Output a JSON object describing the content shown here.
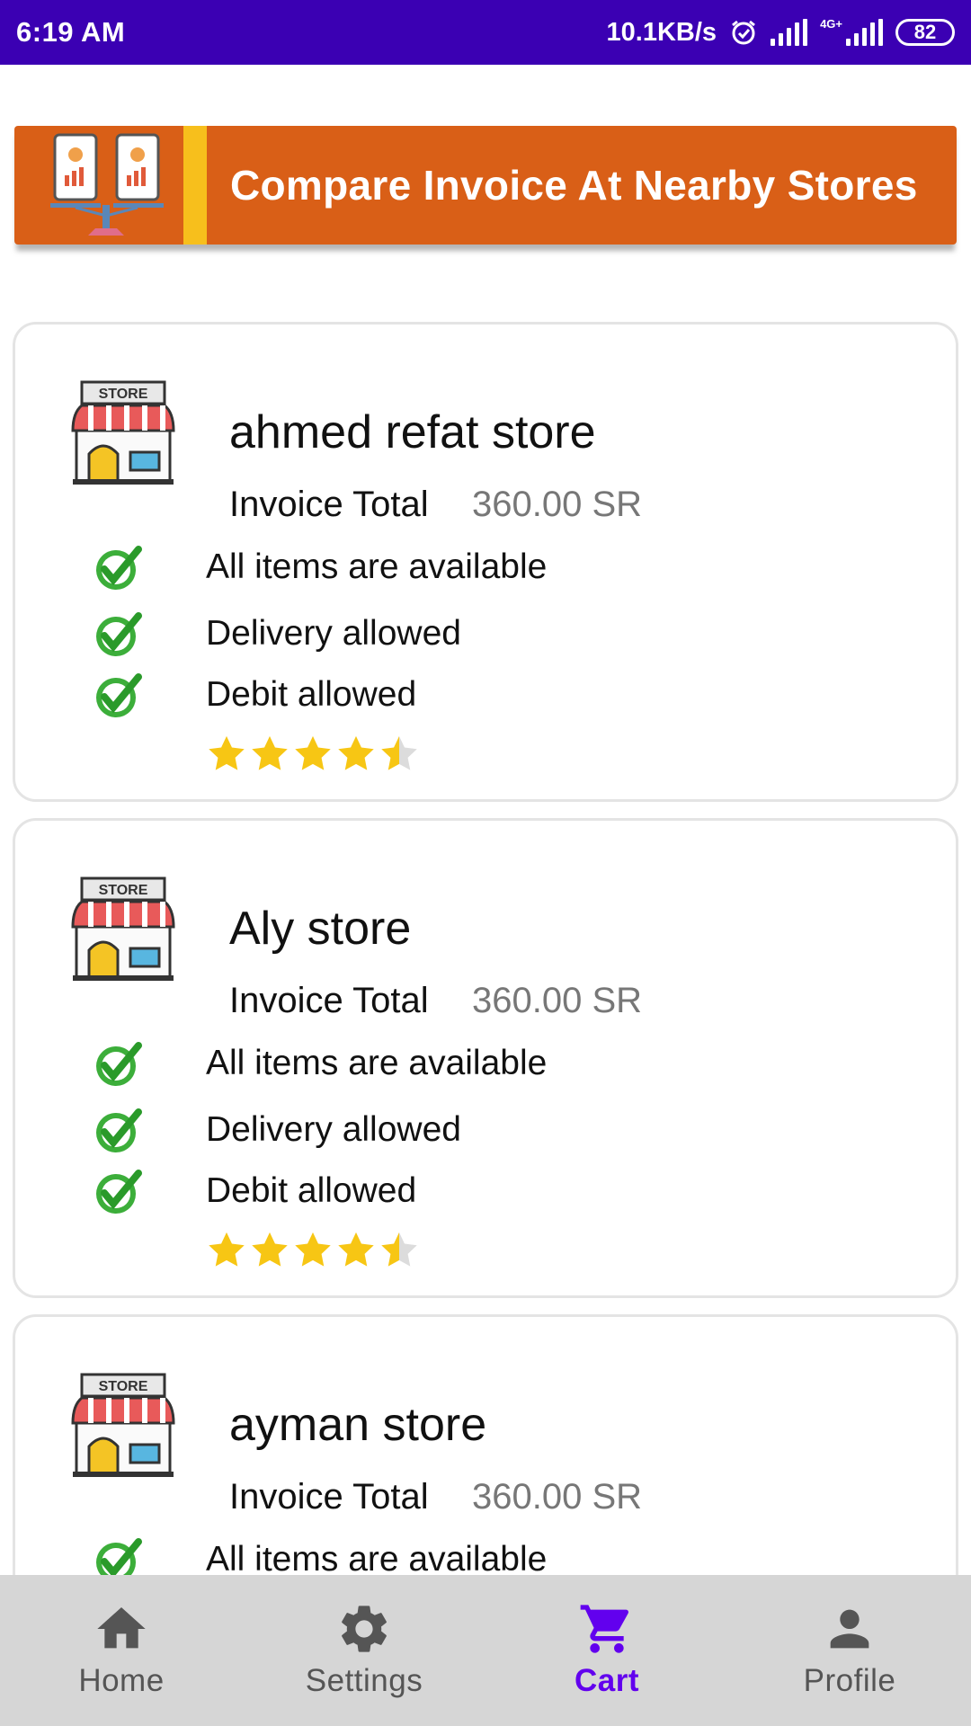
{
  "status_bar": {
    "time": "6:19 AM",
    "network_speed": "10.1KB/s",
    "network_type": "4G+",
    "battery": "82"
  },
  "banner": {
    "title": "Compare Invoice At Nearby Stores",
    "colors": {
      "background": "#d95f17",
      "stripe": "#f7bf1c"
    }
  },
  "stores": [
    {
      "logo_label": "STORE",
      "name": "ahmed refat store",
      "invoice_label": "Invoice Total",
      "invoice_total": "360.00 SR",
      "features": [
        "All items are available",
        "Delivery allowed",
        "Debit allowed"
      ],
      "rating": 4.5
    },
    {
      "logo_label": "STORE",
      "name": "Aly store",
      "invoice_label": "Invoice Total",
      "invoice_total": "360.00 SR",
      "features": [
        "All items are available",
        "Delivery allowed",
        "Debit allowed"
      ],
      "rating": 4.5
    },
    {
      "logo_label": "STORE",
      "name": "ayman store",
      "invoice_label": "Invoice Total",
      "invoice_total": "360.00 SR",
      "features": [
        "All items are available"
      ]
    }
  ],
  "bottom_nav": {
    "items": [
      {
        "label": "Home",
        "icon": "home-icon"
      },
      {
        "label": "Settings",
        "icon": "gear-icon"
      },
      {
        "label": "Cart",
        "icon": "cart-icon",
        "active": true
      },
      {
        "label": "Profile",
        "icon": "person-icon"
      }
    ],
    "colors": {
      "active": "#6200ee",
      "inactive": "#555555",
      "background": "#d6d6d6"
    }
  }
}
